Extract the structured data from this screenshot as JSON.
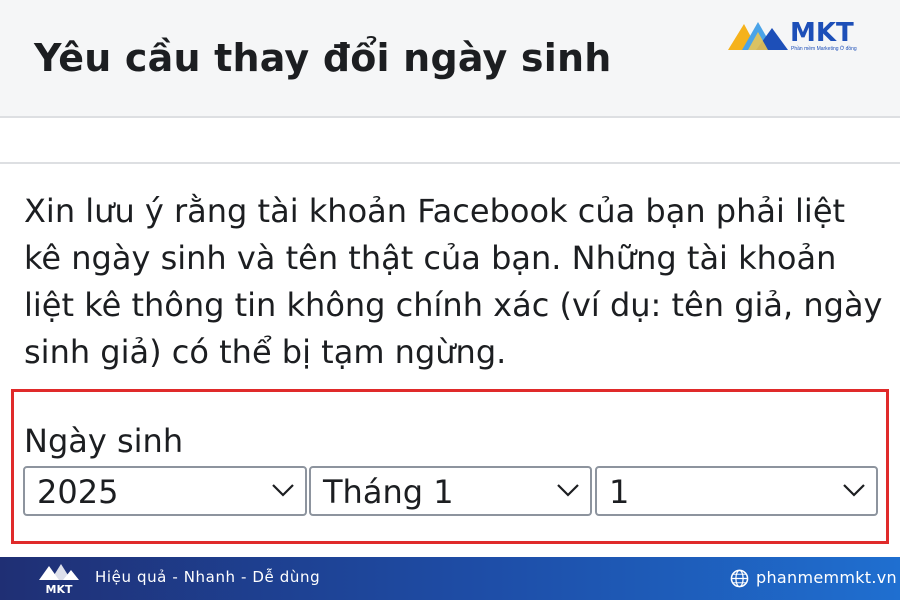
{
  "header": {
    "title": "Yêu cầu thay đổi ngày sinh"
  },
  "brand": {
    "name": "MKT",
    "tagline": "Phần mềm Marketing Ở đồng",
    "logo_icon": "mountain-logo-icon",
    "colors": {
      "blue": "#1d4fb8",
      "yellow": "#f5b21c",
      "light_blue": "#4aa3e8"
    }
  },
  "notice": {
    "text": "Xin lưu ý rằng tài khoản Facebook của bạn phải liệt kê ngày sinh và tên thật của bạn. Những tài khoản liệt kê thông tin không chính xác (ví dụ: tên giả, ngày sinh giả) có thể bị tạm ngừng."
  },
  "birthday": {
    "label": "Ngày sinh",
    "highlight_color": "#e02a2a",
    "year": {
      "value": "2025"
    },
    "month": {
      "value": "Tháng 1"
    },
    "day": {
      "value": "1"
    }
  },
  "footer": {
    "logo_text": "MKT",
    "slogan": "Hiệu quả - Nhanh - Dễ dùng",
    "website": "phanmemmkt.vn",
    "globe_icon": "globe-icon"
  }
}
